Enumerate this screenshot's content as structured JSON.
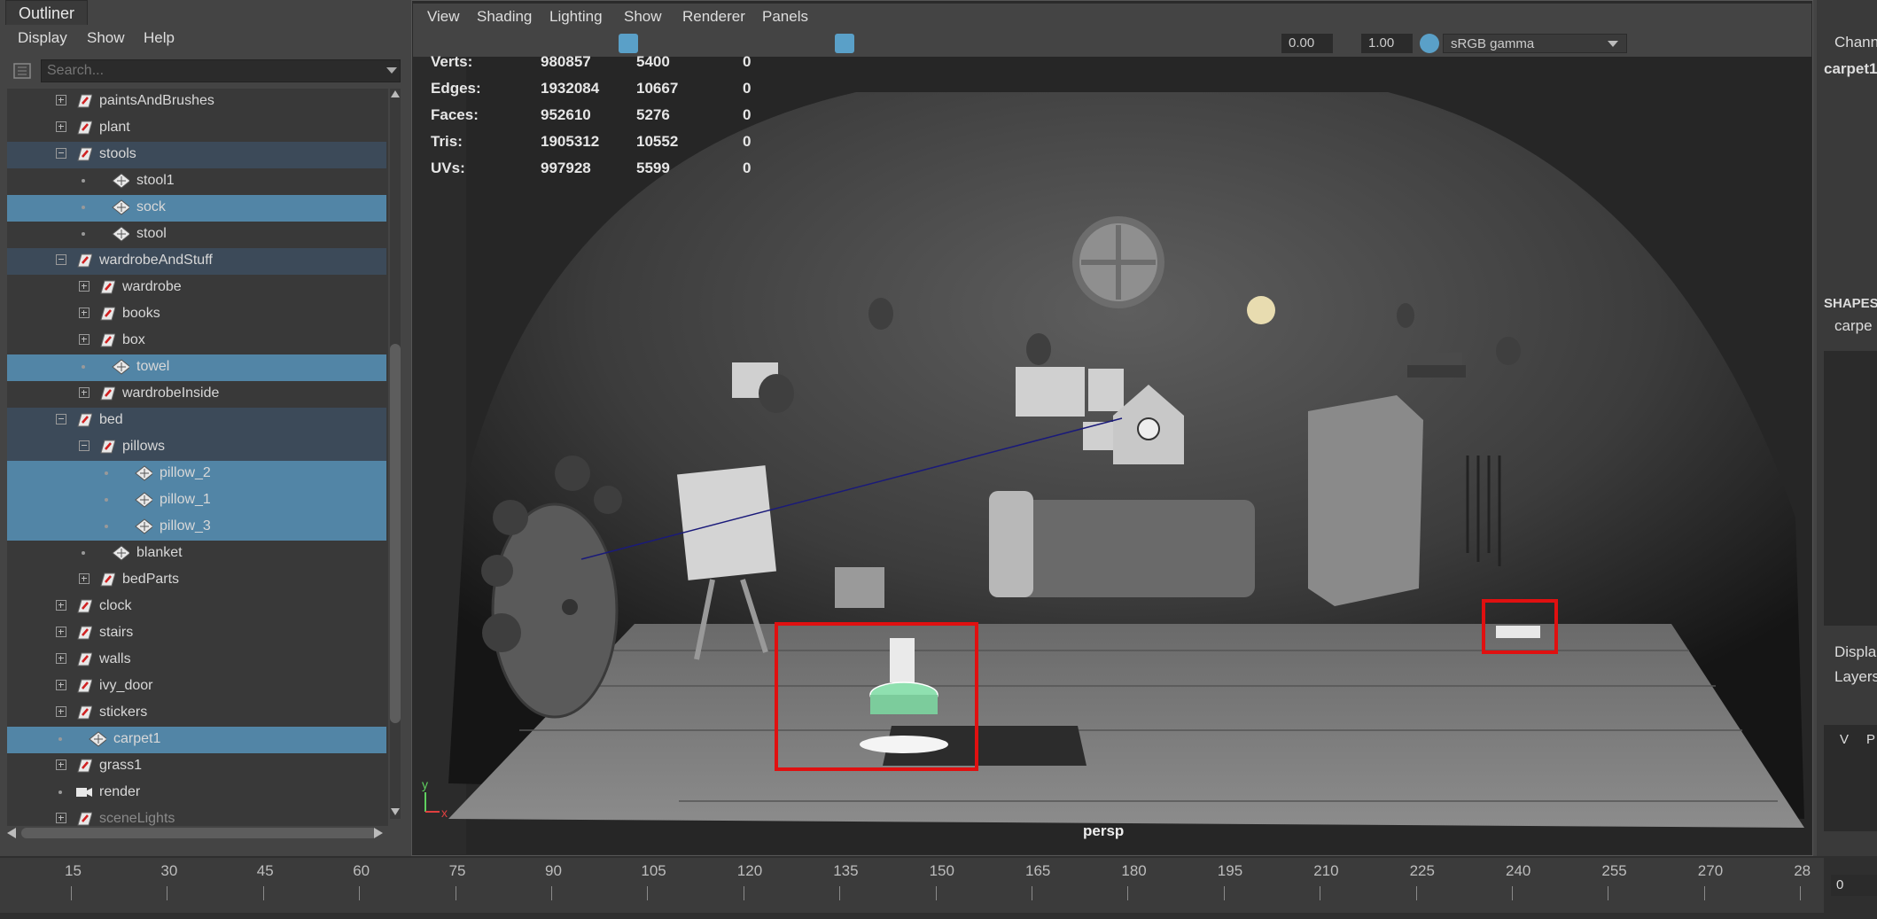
{
  "outliner": {
    "tab": "Outliner",
    "menu": [
      "Display",
      "Show",
      "Help"
    ],
    "search_placeholder": "Search...",
    "items": [
      {
        "label": "paintsAndBrushes",
        "depth": 0,
        "type": "group",
        "expand": "closed",
        "sel": ""
      },
      {
        "label": "plant",
        "depth": 0,
        "type": "group",
        "expand": "closed",
        "sel": ""
      },
      {
        "label": "stools",
        "depth": 0,
        "type": "group",
        "expand": "open",
        "sel": "dark"
      },
      {
        "label": "stool1",
        "depth": 1,
        "type": "mesh",
        "expand": "none",
        "sel": ""
      },
      {
        "label": "sock",
        "depth": 1,
        "type": "mesh",
        "expand": "none",
        "sel": "light"
      },
      {
        "label": "stool",
        "depth": 1,
        "type": "mesh",
        "expand": "none",
        "sel": ""
      },
      {
        "label": "wardrobeAndStuff",
        "depth": 0,
        "type": "group",
        "expand": "open",
        "sel": "dark"
      },
      {
        "label": "wardrobe",
        "depth": 1,
        "type": "group",
        "expand": "closed",
        "sel": ""
      },
      {
        "label": "books",
        "depth": 1,
        "type": "group",
        "expand": "closed",
        "sel": ""
      },
      {
        "label": "box",
        "depth": 1,
        "type": "group",
        "expand": "closed",
        "sel": ""
      },
      {
        "label": "towel",
        "depth": 1,
        "type": "mesh",
        "expand": "none",
        "sel": "light"
      },
      {
        "label": "wardrobeInside",
        "depth": 1,
        "type": "group",
        "expand": "closed",
        "sel": ""
      },
      {
        "label": "bed",
        "depth": 0,
        "type": "group",
        "expand": "open",
        "sel": "dark"
      },
      {
        "label": "pillows",
        "depth": 1,
        "type": "group",
        "expand": "open",
        "sel": "dark"
      },
      {
        "label": "pillow_2",
        "depth": 2,
        "type": "mesh",
        "expand": "none",
        "sel": "light"
      },
      {
        "label": "pillow_1",
        "depth": 2,
        "type": "mesh",
        "expand": "none",
        "sel": "light"
      },
      {
        "label": "pillow_3",
        "depth": 2,
        "type": "mesh",
        "expand": "none",
        "sel": "light"
      },
      {
        "label": "blanket",
        "depth": 1,
        "type": "mesh",
        "expand": "none",
        "sel": ""
      },
      {
        "label": "bedParts",
        "depth": 1,
        "type": "group",
        "expand": "closed",
        "sel": ""
      },
      {
        "label": "clock",
        "depth": 0,
        "type": "group",
        "expand": "closed",
        "sel": ""
      },
      {
        "label": "stairs",
        "depth": 0,
        "type": "group",
        "expand": "closed",
        "sel": ""
      },
      {
        "label": "walls",
        "depth": 0,
        "type": "group",
        "expand": "closed",
        "sel": ""
      },
      {
        "label": "ivy_door",
        "depth": 0,
        "type": "group",
        "expand": "closed",
        "sel": ""
      },
      {
        "label": "stickers",
        "depth": 0,
        "type": "group",
        "expand": "closed",
        "sel": ""
      },
      {
        "label": "carpet1",
        "depth": 0,
        "type": "mesh",
        "expand": "none",
        "sel": "light"
      },
      {
        "label": "grass1",
        "depth": 0,
        "type": "group",
        "expand": "closed",
        "sel": ""
      },
      {
        "label": "render",
        "depth": 0,
        "type": "camera",
        "expand": "none",
        "sel": ""
      },
      {
        "label": "sceneLights",
        "depth": 0,
        "type": "group",
        "expand": "closed",
        "sel": "",
        "dim": true
      }
    ]
  },
  "viewport": {
    "menu": [
      "View",
      "Shading",
      "Lighting",
      "Show",
      "Renderer",
      "Panels"
    ],
    "toolbar": {
      "exposure": "0.00",
      "gamma": "1.00",
      "color_space": "sRGB gamma"
    },
    "camera_label": "persp",
    "hud": [
      {
        "label": "Verts:",
        "a": "980857",
        "b": "5400",
        "c": "0"
      },
      {
        "label": "Edges:",
        "a": "1932084",
        "b": "10667",
        "c": "0"
      },
      {
        "label": "Faces:",
        "a": "952610",
        "b": "5276",
        "c": "0"
      },
      {
        "label": "Tris:",
        "a": "1905312",
        "b": "10552",
        "c": "0"
      },
      {
        "label": "UVs:",
        "a": "997928",
        "b": "5599",
        "c": "0"
      }
    ]
  },
  "right_panel": {
    "channel_box": "Channe",
    "object": "carpet1",
    "shapes": "SHAPES",
    "shape": "carpe",
    "display": "Displa",
    "layers": "Layers",
    "v": "V",
    "p": "P"
  },
  "timeline": {
    "ticks": [
      "15",
      "30",
      "45",
      "60",
      "75",
      "90",
      "105",
      "120",
      "135",
      "150",
      "165",
      "180",
      "195",
      "210",
      "225",
      "240",
      "255",
      "270",
      "28"
    ],
    "current_frame": "0"
  }
}
